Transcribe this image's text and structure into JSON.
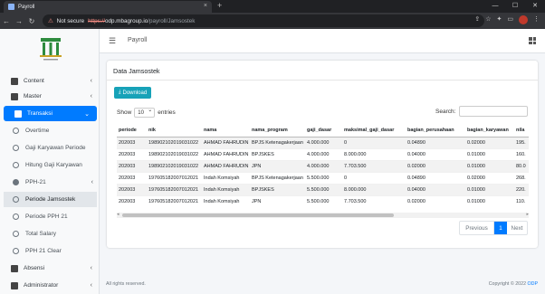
{
  "browser": {
    "tab_title": "Payroll",
    "security_label": "Not secure",
    "url_scheme": "https://",
    "url_host": "odp.mbagroup.io",
    "url_path": "/payroll/Jamsostek"
  },
  "header": {
    "app_name": "Payroll"
  },
  "sidebar": {
    "items": [
      {
        "label": "Content"
      },
      {
        "label": "Master"
      },
      {
        "label": "Transaksi"
      }
    ],
    "sub_items": [
      {
        "label": "Overtime"
      },
      {
        "label": "Gaji Karyawan Periode"
      },
      {
        "label": "Hitung Gaji Karyawan"
      },
      {
        "label": "PPH-21"
      },
      {
        "label": "Periode Jamsostek"
      },
      {
        "label": "Periode PPH 21"
      },
      {
        "label": "Total Salary"
      },
      {
        "label": "PPH 21 Clear"
      }
    ],
    "bottom_items": [
      {
        "label": "Absensi"
      },
      {
        "label": "Administrator"
      }
    ]
  },
  "card": {
    "title": "Data Jamsostek",
    "download_label": "Download",
    "show_label": "Show",
    "entries_value": "10",
    "entries_label": "entries",
    "search_label": "Search:"
  },
  "table": {
    "headers": [
      "periode",
      "nik",
      "nama",
      "nama_program",
      "gaji_dasar",
      "maksimal_gaji_dasar",
      "bagian_perusahaan",
      "bagian_karyawan",
      "nila"
    ],
    "rows": [
      [
        "202003",
        "198902102019031022",
        "AHMAD FAHRUDIN",
        "BPJS Ketenagakerjaan",
        "4.000.000",
        "0",
        "0.04890",
        "0.02000",
        "195."
      ],
      [
        "202003",
        "198902102019031022",
        "AHMAD FAHRUDIN",
        "BPJSKES",
        "4.000.000",
        "8.000.000",
        "0.04000",
        "0.01000",
        "160."
      ],
      [
        "202003",
        "198902102019031022",
        "AHMAD FAHRUDIN",
        "JPN",
        "4.000.000",
        "7.703.500",
        "0.02000",
        "0.01000",
        "80.0"
      ],
      [
        "202003",
        "197605182007012021",
        "Indah Komsiyah",
        "BPJS Ketenagakerjaan",
        "5.500.000",
        "0",
        "0.04890",
        "0.02000",
        "268."
      ],
      [
        "202003",
        "197605182007012021",
        "Indah Komsiyah",
        "BPJSKES",
        "5.500.000",
        "8.000.000",
        "0.04000",
        "0.01000",
        "220."
      ],
      [
        "202003",
        "197605182007012021",
        "Indah Komsiyah",
        "JPN",
        "5.500.000",
        "7.703.500",
        "0.02000",
        "0.01000",
        "110."
      ]
    ]
  },
  "pagination": {
    "previous": "Previous",
    "page": "1",
    "next": "Next"
  },
  "footer": {
    "left": "All rights reserved.",
    "right_prefix": "Copyright © 2022",
    "right_brand": "ODP"
  }
}
